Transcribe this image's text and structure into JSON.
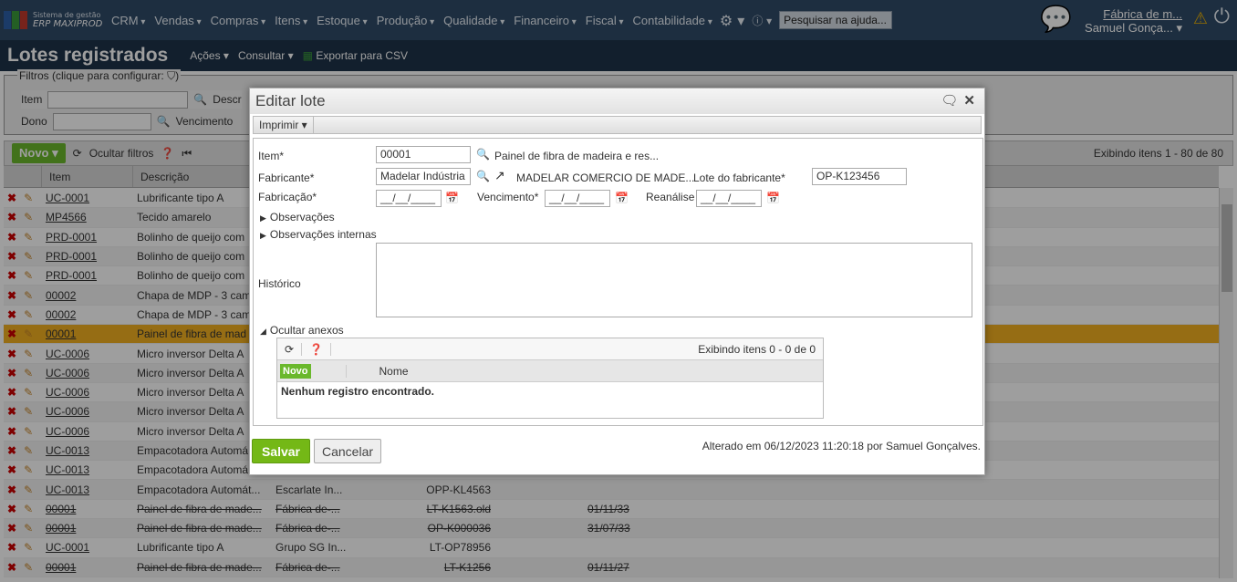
{
  "topbar": {
    "logo_line1": "Sistema de gestão",
    "logo_line2": "ERP MAXIPROD",
    "menu": [
      "CRM",
      "Vendas",
      "Compras",
      "Itens",
      "Estoque",
      "Produção",
      "Qualidade",
      "Financeiro",
      "Fiscal",
      "Contabilidade"
    ],
    "search_placeholder": "Pesquisar na ajuda...",
    "company": "Fábrica de m...",
    "user": "Samuel Gonça..."
  },
  "page": {
    "title": "Lotes registrados",
    "actions": "Ações ▾",
    "consultar": "Consultar ▾",
    "export": "Exportar para CSV"
  },
  "filters": {
    "legend": "Filtros (clique para configurar: ⛉)",
    "item": "Item",
    "descricao": "Descr",
    "dono": "Dono",
    "vencimento": "Vencimento"
  },
  "grid": {
    "novo": "Novo",
    "hide_filters": "Ocultar filtros",
    "count": "Exibindo itens 1 - 80 de 80",
    "col_item": "Item",
    "col_desc": "Descrição",
    "rows": [
      {
        "item": "UC-0001",
        "desc": "Lubrificante tipo A",
        "fab": "",
        "lote": "",
        "venc": ""
      },
      {
        "item": "MP4566",
        "desc": "Tecido amarelo",
        "fab": "",
        "lote": "",
        "venc": ""
      },
      {
        "item": "PRD-0001",
        "desc": "Bolinho de queijo com",
        "fab": "",
        "lote": "",
        "venc": ""
      },
      {
        "item": "PRD-0001",
        "desc": "Bolinho de queijo com",
        "fab": "",
        "lote": "",
        "venc": ""
      },
      {
        "item": "PRD-0001",
        "desc": "Bolinho de queijo com",
        "fab": "",
        "lote": "",
        "venc": ""
      },
      {
        "item": "00002",
        "desc": "Chapa de MDP - 3 cam",
        "fab": "",
        "lote": "",
        "venc": ""
      },
      {
        "item": "00002",
        "desc": "Chapa de MDP - 3 cam",
        "fab": "",
        "lote": "",
        "venc": ""
      },
      {
        "item": "00001",
        "desc": "Painel de fibra de mad",
        "fab": "",
        "lote": "",
        "venc": "",
        "selected": true
      },
      {
        "item": "UC-0006",
        "desc": "Micro inversor Delta A",
        "fab": "",
        "lote": "",
        "venc": ""
      },
      {
        "item": "UC-0006",
        "desc": "Micro inversor Delta A",
        "fab": "",
        "lote": "",
        "venc": ""
      },
      {
        "item": "UC-0006",
        "desc": "Micro inversor Delta A",
        "fab": "",
        "lote": "",
        "venc": ""
      },
      {
        "item": "UC-0006",
        "desc": "Micro inversor Delta A",
        "fab": "",
        "lote": "",
        "venc": ""
      },
      {
        "item": "UC-0006",
        "desc": "Micro inversor Delta A",
        "fab": "",
        "lote": "",
        "venc": ""
      },
      {
        "item": "UC-0013",
        "desc": "Empacotadora Automá",
        "fab": "",
        "lote": "",
        "venc": ""
      },
      {
        "item": "UC-0013",
        "desc": "Empacotadora Automá",
        "fab": "",
        "lote": "",
        "venc": ""
      },
      {
        "item": "UC-0013",
        "desc": "Empacotadora Automát...",
        "fab": "Escarlate In...",
        "lote": "OPP-KL4563",
        "venc": ""
      },
      {
        "item": "00001",
        "desc": "Painel de fibra de made...",
        "fab": "Fábrica de-...",
        "lote": "LT-K1563.old",
        "venc": "01/11/33",
        "struck": true
      },
      {
        "item": "00001",
        "desc": "Painel de fibra de made...",
        "fab": "Fábrica de-...",
        "lote": "OP-K000036",
        "venc": "31/07/33",
        "struck": true
      },
      {
        "item": "UC-0001",
        "desc": "Lubrificante tipo A",
        "fab": "Grupo SG In...",
        "lote": "LT-OP78956",
        "venc": ""
      },
      {
        "item": "00001",
        "desc": "Painel de fibra de made...",
        "fab": "Fábrica de-...",
        "lote": "LT-K1256",
        "venc": "01/11/27",
        "struck": true
      }
    ]
  },
  "dialog": {
    "title": "Editar lote",
    "print": "Imprimir ▾",
    "item_label": "Item*",
    "item_value": "00001",
    "item_desc": "Painel de fibra de madeira e res...",
    "fab_label": "Fabricante*",
    "fab_value": "Madelar Indústria",
    "fab_desc": "MADELAR COMERCIO DE MADE...",
    "lote_label": "Lote do fabricante*",
    "lote_value": "OP-K123456",
    "fabricacao_label": "Fabricação*",
    "fabricacao_value": "__/__/____",
    "venc_label": "Vencimento*",
    "venc_value": "__/__/____",
    "reanalise_label": "Reanálise",
    "reanalise_value": "__/__/____",
    "obs": "Observações",
    "obs_int": "Observações internas",
    "historico": "Histórico",
    "anexos": "Ocultar anexos",
    "att_count": "Exibindo itens 0 - 0 de 0",
    "att_novo": "Novo",
    "att_nome": "Nome",
    "att_empty": "Nenhum registro encontrado.",
    "save": "Salvar",
    "cancel": "Cancelar",
    "altered": "Alterado em 06/12/2023 11:20:18 por Samuel Gonçalves."
  }
}
